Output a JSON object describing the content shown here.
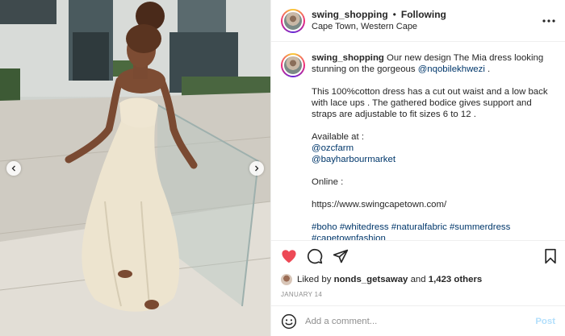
{
  "header": {
    "username": "swing_shopping",
    "separator": "•",
    "follow_status": "Following",
    "location": "Cape Town, Western Cape"
  },
  "caption": {
    "username": "swing_shopping",
    "intro": "Our new design The Mia dress looking stunning on the gorgeous",
    "mention_model": "@nqobilekhwezi",
    "intro_end": ".",
    "paragraph2": "This 100%cotton dress has a cut out waist and a low back with lace ups . The gathered bodice gives support and straps are adjustable to fit sizes 6 to 12 .",
    "available_label": "Available at :",
    "store1": "@ozcfarm",
    "store2": "@bayharbourmarket",
    "online_label": "Online :",
    "website": "https://www.swingcapetown.com/",
    "hashtags_line1": "#boho #whitedress #naturalfabric #summerdress",
    "hashtags_line2": "#capetownfashion"
  },
  "likes": {
    "prefix": "Liked by",
    "user": "nonds_getsaway",
    "and": "and",
    "others": "1,423 others"
  },
  "date": "JANUARY 14",
  "comment": {
    "placeholder": "Add a comment...",
    "post_label": "Post"
  },
  "colors": {
    "like_red": "#ed4956",
    "link_blue": "#00376b",
    "post_disabled": "#b2dffc"
  },
  "icons": [
    "chevron-left-icon",
    "chevron-right-icon",
    "more-icon",
    "heart-icon",
    "comment-icon",
    "share-icon",
    "bookmark-icon",
    "emoji-icon"
  ]
}
